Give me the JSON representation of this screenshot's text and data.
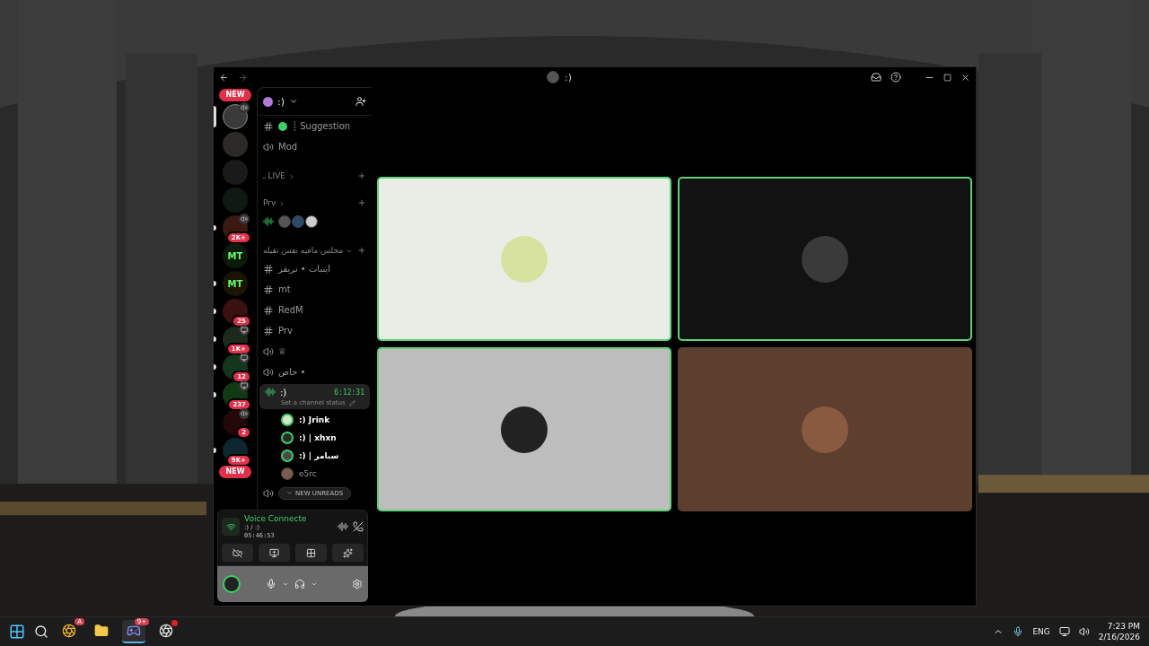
{
  "window": {
    "title": ":)"
  },
  "servers": [
    {
      "kind": "pill",
      "label": "NEW",
      "unread": false,
      "selected": false
    },
    {
      "kind": "icon",
      "color": "#3a3a3a",
      "selected": true,
      "unread": false,
      "speaker": true
    },
    {
      "kind": "icon",
      "color": "#2c2a26",
      "selected": false,
      "unread": false
    },
    {
      "kind": "icon",
      "color": "#1a1a1a",
      "selected": false,
      "unread": false
    },
    {
      "kind": "icon",
      "color": "#101a12",
      "selected": false,
      "unread": false
    },
    {
      "kind": "icon",
      "color": "#3a1a10",
      "selected": false,
      "unread": true,
      "speaker": true,
      "badge": "2K+"
    },
    {
      "kind": "icon",
      "color": "#0c1a0c",
      "label": "MT",
      "selected": false,
      "unread": false
    },
    {
      "kind": "icon",
      "color": "#1a1404",
      "label": "MT",
      "selected": false,
      "unread": true
    },
    {
      "kind": "icon",
      "color": "#3a1010",
      "selected": false,
      "unread": true,
      "badge": "25"
    },
    {
      "kind": "icon",
      "color": "#1c2a1c",
      "selected": false,
      "unread": true,
      "screen": true,
      "badge": "1K+"
    },
    {
      "kind": "icon",
      "color": "#14361a",
      "selected": false,
      "unread": true,
      "screen": true,
      "badge": "12"
    },
    {
      "kind": "icon",
      "color": "#123a12",
      "selected": false,
      "unread": true,
      "screen": true,
      "badge": "237"
    },
    {
      "kind": "icon",
      "color": "#220808",
      "selected": false,
      "unread": false,
      "speaker": true,
      "badge": "2"
    },
    {
      "kind": "icon",
      "color": "#0e2630",
      "selected": false,
      "unread": true,
      "badge": "9K+"
    },
    {
      "kind": "pill",
      "label": "NEW",
      "unread": false,
      "selected": false
    }
  ],
  "server": {
    "name": ":)"
  },
  "channels": [
    {
      "kind": "text",
      "name": "┊ Suggestion",
      "status_dot": true
    },
    {
      "kind": "voice",
      "name": "Mod"
    },
    {
      "kind": "category",
      "name": "ـ LIVE",
      "expanded": false
    },
    {
      "kind": "category",
      "name": "Prv",
      "expanded": false
    },
    {
      "kind": "voice-preview",
      "avatars": [
        {
          "color": "#555555"
        },
        {
          "color": "#2a4a6a"
        },
        {
          "color": "#cccccc"
        }
      ]
    },
    {
      "kind": "category",
      "name": "مجلس مافيه نفس ثقيله",
      "expanded": true
    },
    {
      "kind": "text",
      "name": "اينبات • تريقر"
    },
    {
      "kind": "text",
      "name": "mt"
    },
    {
      "kind": "text",
      "name": "RedM"
    },
    {
      "kind": "text",
      "name": "Prv"
    },
    {
      "kind": "voice",
      "name": "♕"
    },
    {
      "kind": "voice",
      "name": "خاص •"
    },
    {
      "kind": "voice-active",
      "name": ":)",
      "time": "6:12:31",
      "status": "Set a channel status",
      "members": [
        {
          "name": ":) Jrink",
          "speaking": true,
          "color": "#d8e6c8"
        },
        {
          "name": ":) | xhxn",
          "speaking": true,
          "color": "#2a2a2a"
        },
        {
          "name": ":) | سبامر",
          "speaking": true,
          "color": "#4a4a4a"
        },
        {
          "name": "e5rc",
          "speaking": false,
          "color": "#7a5a48"
        }
      ]
    },
    {
      "kind": "voice-unreads",
      "label": "NEW UNREADS"
    }
  ],
  "voice": {
    "status": "Voice Connecte",
    "channel": ":) / :)",
    "time": "05:46:53"
  },
  "tiles": [
    {
      "color": "#e8eee6",
      "speaking": true,
      "avatar": {
        "color": "#d8e2a0"
      }
    },
    {
      "color": "#121212",
      "speaking": true,
      "avatar": {
        "color": "#3a3a3a"
      }
    },
    {
      "color": "#bdbdbd",
      "speaking": true,
      "avatar": {
        "color": "#222222"
      }
    },
    {
      "color": "#5c3f2f",
      "speaking": false,
      "avatar": {
        "color": "#8a5a40"
      }
    }
  ],
  "taskbar": {
    "apps": [
      {
        "kind": "chrome",
        "badge": "A",
        "selected": false
      },
      {
        "kind": "files",
        "selected": false
      },
      {
        "kind": "discord",
        "badge": "9+",
        "selected": true
      },
      {
        "kind": "obs",
        "dot": true,
        "selected": false
      }
    ],
    "language": "ENG",
    "time": "7:23 PM",
    "date": "2/16/2026"
  }
}
